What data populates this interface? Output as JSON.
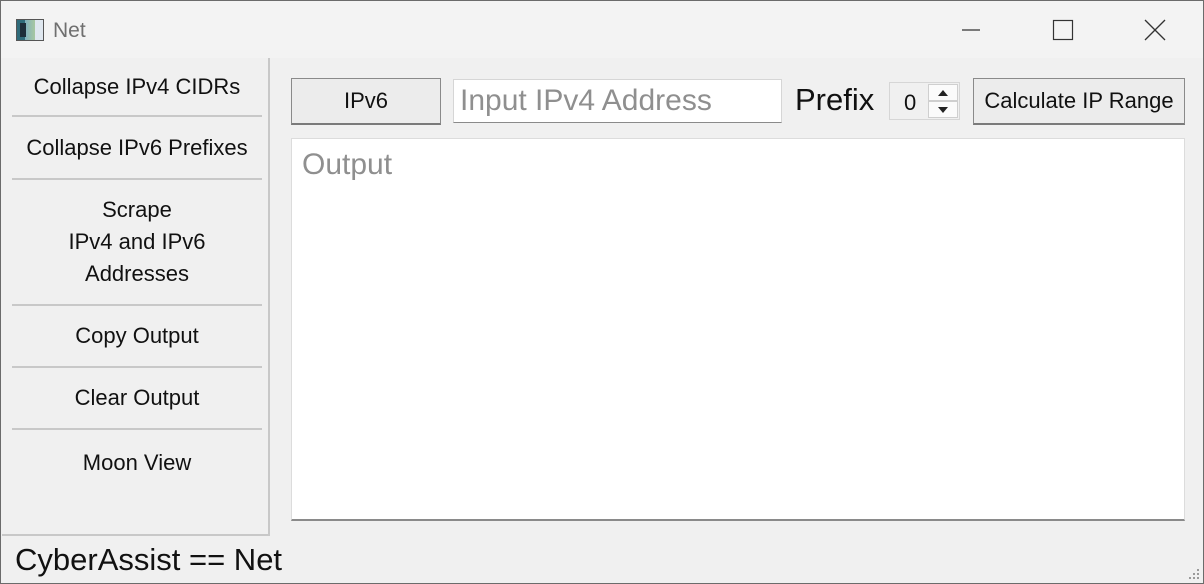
{
  "window": {
    "title": "Net",
    "icon": "app-icon"
  },
  "controls": {
    "minimize": "minimize-icon",
    "maximize": "maximize-icon",
    "close": "close-icon"
  },
  "sidebar": {
    "items": [
      {
        "label": "Collapse IPv4 CIDRs"
      },
      {
        "label": "Collapse IPv6 Prefixes"
      },
      {
        "label": "Scrape\nIPv4 and IPv6\nAddresses"
      },
      {
        "label": "Copy Output"
      },
      {
        "label": "Clear Output"
      },
      {
        "label": "Moon View"
      }
    ]
  },
  "toolbar": {
    "ipv6_label": "IPv6",
    "address_placeholder": "Input IPv4 Address",
    "address_value": "",
    "prefix_label": "Prefix",
    "prefix_value": "0",
    "calculate_label": "Calculate IP Range"
  },
  "output": {
    "placeholder": "Output",
    "value": ""
  },
  "status": {
    "text": "CyberAssist == Net"
  }
}
